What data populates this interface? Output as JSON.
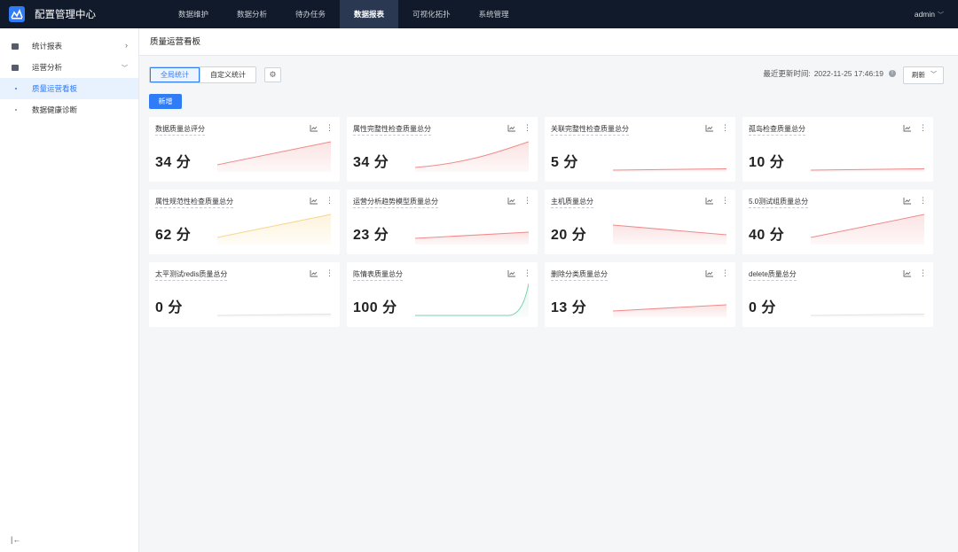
{
  "app": {
    "title": "配置管理中心",
    "logo_icon": "logo-icon"
  },
  "nav": {
    "items": [
      {
        "label": "数据维护",
        "active": false
      },
      {
        "label": "数据分析",
        "active": false
      },
      {
        "label": "待办任务",
        "active": false
      },
      {
        "label": "数据报表",
        "active": true
      },
      {
        "label": "可视化拓扑",
        "active": false
      },
      {
        "label": "系统管理",
        "active": false
      }
    ],
    "user": "admin"
  },
  "sidebar": {
    "groups": [
      {
        "label": "统计报表",
        "icon": "report-icon",
        "expanded": false
      },
      {
        "label": "运营分析",
        "icon": "analysis-icon",
        "expanded": true
      }
    ],
    "sub_items": [
      {
        "label": "质量运营看板",
        "active": true
      },
      {
        "label": "数据健康诊断",
        "active": false
      }
    ]
  },
  "page": {
    "title": "质量运营看板",
    "tabs": [
      "全局统计",
      "自定义统计"
    ],
    "active_tab": "全局统计",
    "add_label": "新增",
    "updated_label": "最近更新时间:",
    "updated_time": "2022-11-25 17:46:19",
    "refresh_label": "刷新"
  },
  "colors": {
    "accent": "#2f7cf6",
    "topbar": "#111a2b",
    "red_line": "#f08a8a",
    "red_fill": "#fbe3e3",
    "yellow_line": "#f6d58a",
    "yellow_fill": "#fdf4dd",
    "green_line": "#7fd1ae",
    "green_fill": "#e6f6ef",
    "gray_line": "#e2e2e2"
  },
  "cards": [
    {
      "title": "数据质量总评分",
      "value": "34 分",
      "trend": "up",
      "color": "red"
    },
    {
      "title": "属性完整性检查质量总分",
      "value": "34 分",
      "trend": "up-curve",
      "color": "red"
    },
    {
      "title": "关联完整性检查质量总分",
      "value": "5 分",
      "trend": "flat",
      "color": "red"
    },
    {
      "title": "孤岛检查质量总分",
      "value": "10 分",
      "trend": "flat",
      "color": "red"
    },
    {
      "title": "属性规范性检查质量总分",
      "value": "62 分",
      "trend": "up",
      "color": "yellow"
    },
    {
      "title": "运营分析趋势模型质量总分",
      "value": "23 分",
      "trend": "up-slight",
      "color": "red"
    },
    {
      "title": "主机质量总分",
      "value": "20 分",
      "trend": "down",
      "color": "red"
    },
    {
      "title": "5.0测试组质量总分",
      "value": "40 分",
      "trend": "up",
      "color": "red"
    },
    {
      "title": "太平测试redis质量总分",
      "value": "0 分",
      "trend": "flat",
      "color": "gray"
    },
    {
      "title": "陈情表质量总分",
      "value": "100 分",
      "trend": "spike",
      "color": "green"
    },
    {
      "title": "删除分类质量总分",
      "value": "13 分",
      "trend": "up-slight",
      "color": "red"
    },
    {
      "title": "delete质量总分",
      "value": "0 分",
      "trend": "flat",
      "color": "gray"
    }
  ]
}
